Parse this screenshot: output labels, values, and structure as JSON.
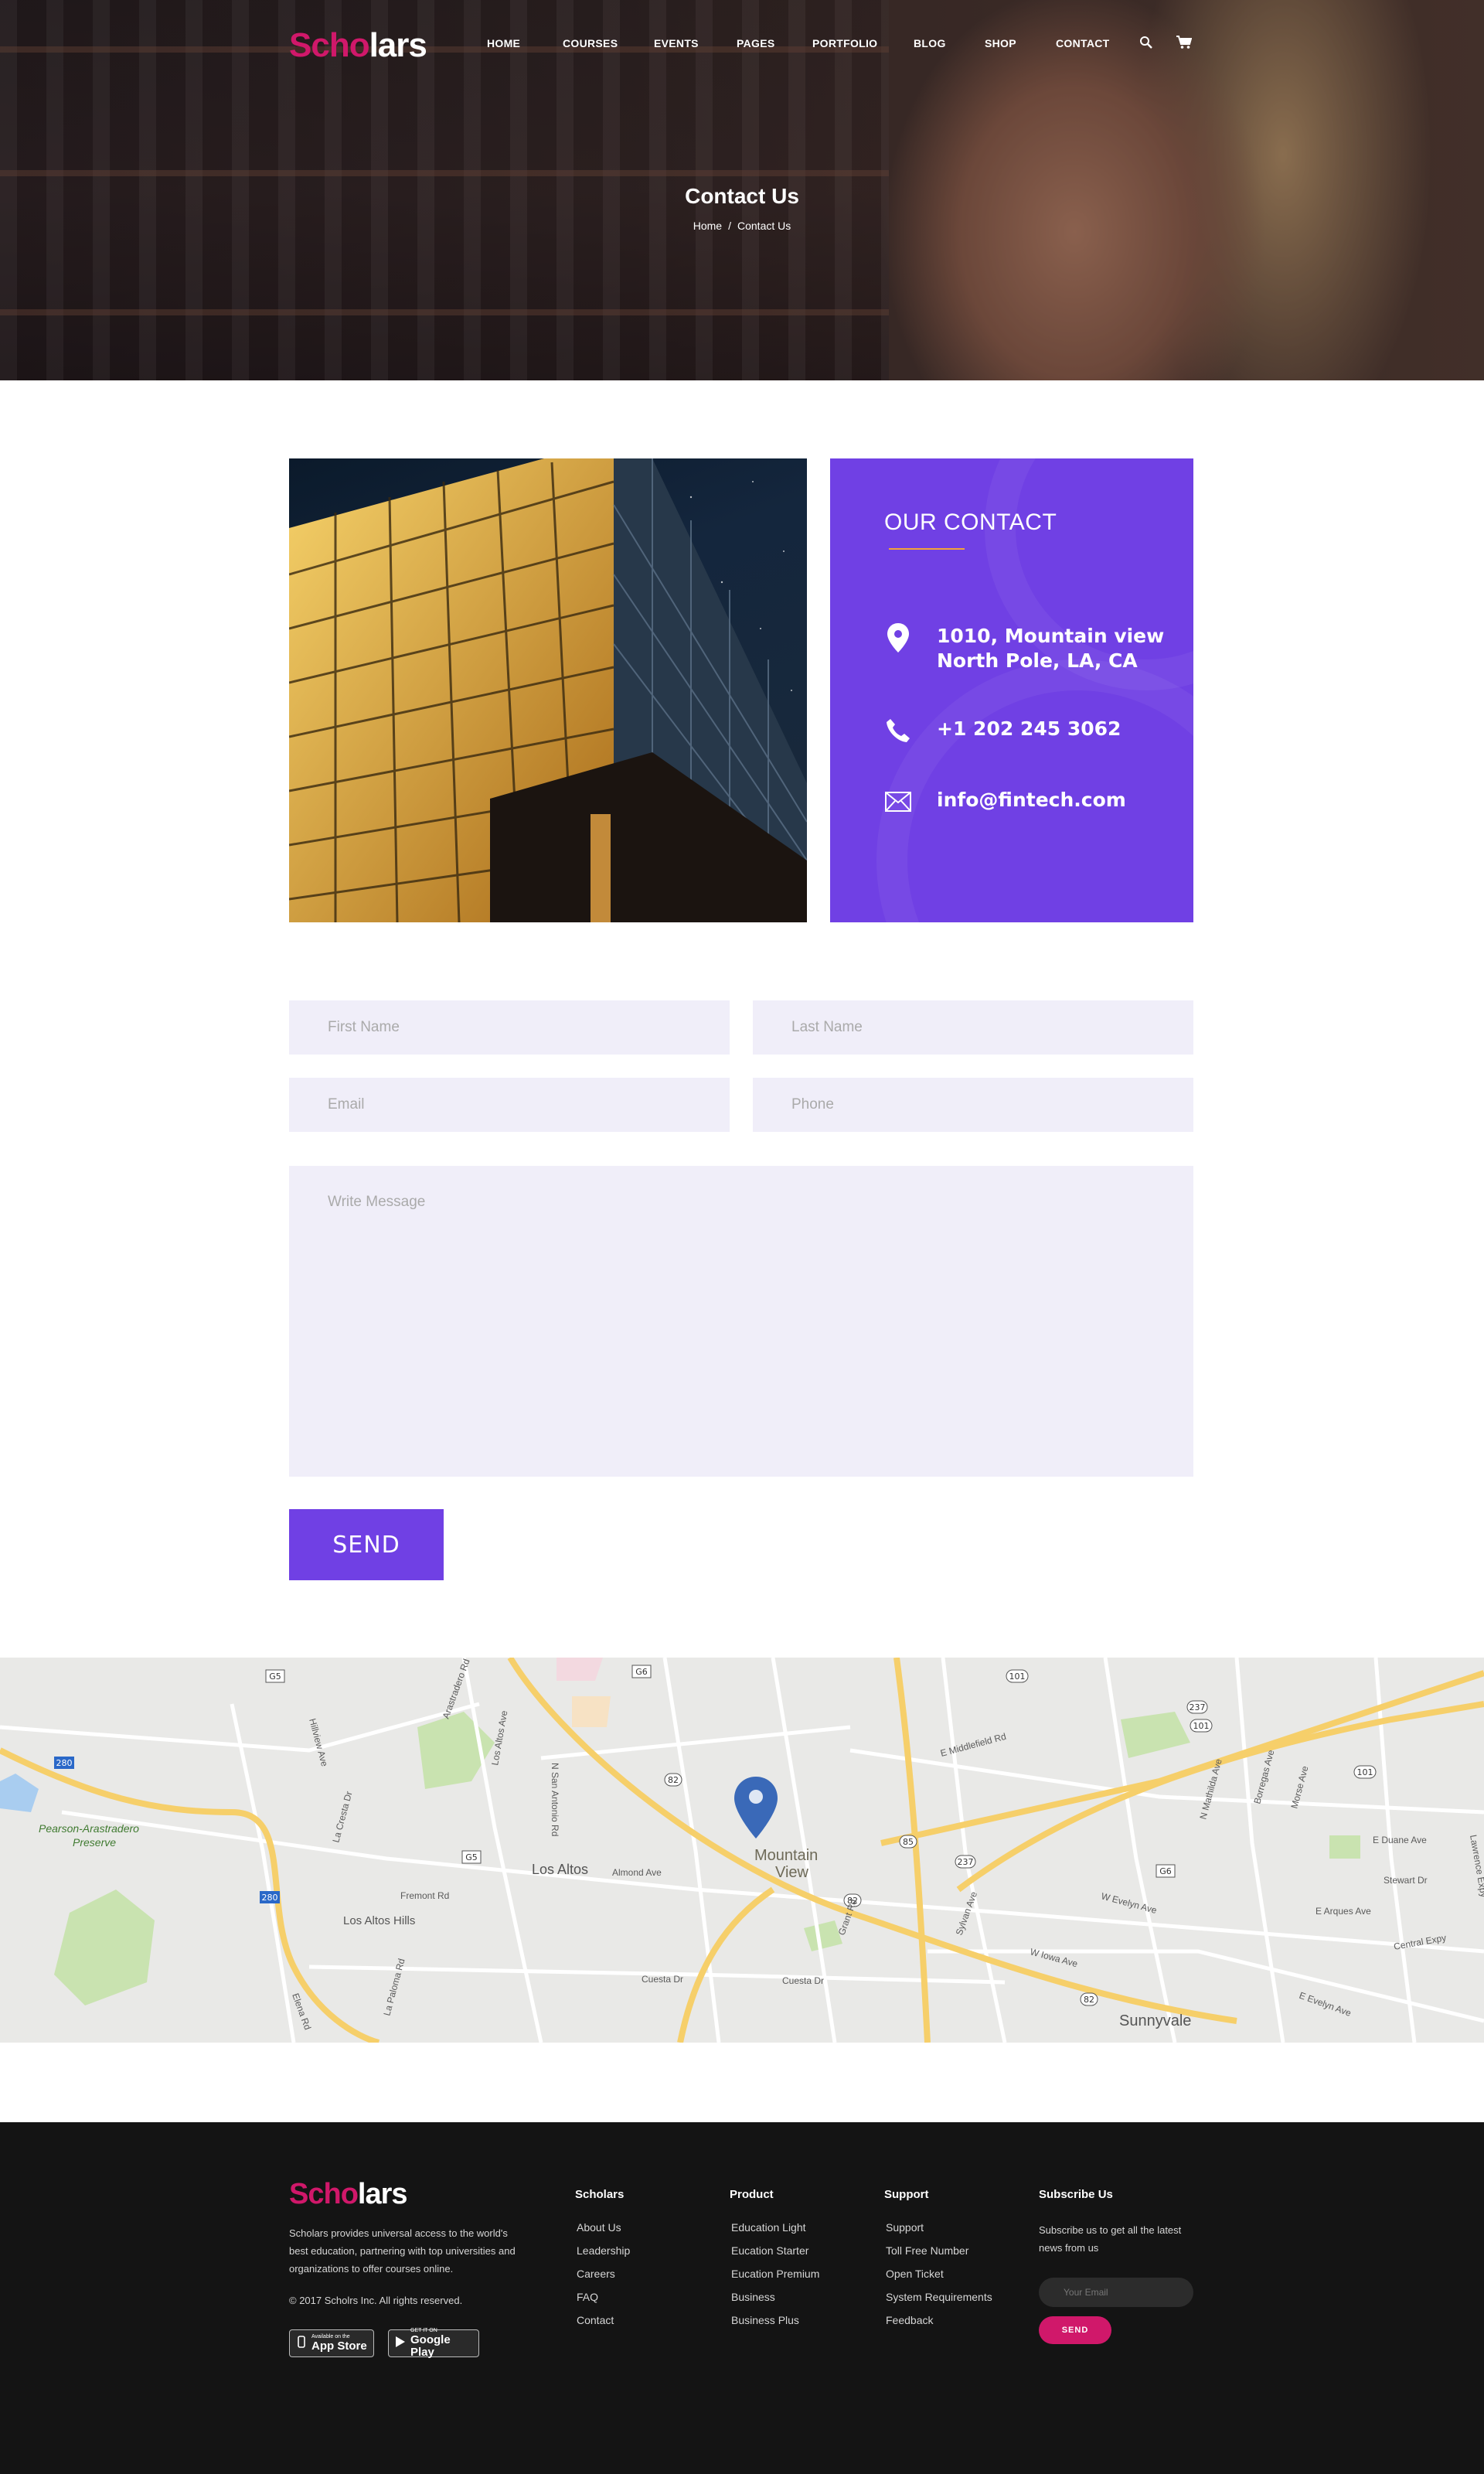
{
  "brand": {
    "logo_part1": "Scho",
    "logo_part2": "lars",
    "accent_color": "#d0186a",
    "primary_color": "#7040e4"
  },
  "nav": {
    "items": [
      {
        "label": "HOME"
      },
      {
        "label": "COURSES"
      },
      {
        "label": "EVENTS"
      },
      {
        "label": "PAGES"
      },
      {
        "label": "PORTFOLIO"
      },
      {
        "label": "BLOG"
      },
      {
        "label": "SHOP"
      },
      {
        "label": "CONTACT"
      }
    ],
    "icons": [
      "search-icon",
      "cart-icon"
    ]
  },
  "hero": {
    "title": "Contact Us",
    "breadcrumb": {
      "home": "Home",
      "separator": "/",
      "current": "Contact Us"
    }
  },
  "contact_card": {
    "title": "OUR CONTACT",
    "address_line1": "1010, Mountain view",
    "address_line2": "North Pole, LA, CA",
    "phone": "+1 202 245 3062",
    "email": "info@fintech.com",
    "icons": [
      "location-pin-icon",
      "phone-icon",
      "envelope-icon"
    ]
  },
  "form": {
    "first_name_placeholder": "First Name",
    "last_name_placeholder": "Last Name",
    "email_placeholder": "Email",
    "phone_placeholder": "Phone",
    "message_placeholder": "Write Message",
    "send_label": "SEND"
  },
  "map": {
    "labels": {
      "mountain_view_1": "Mountain",
      "mountain_view_2": "View",
      "los_altos": "Los Altos",
      "los_altos_hills": "Los Altos Hills",
      "sunnyvale": "Sunnyvale",
      "preserve_1": "Pearson-Arastradero",
      "preserve_2": "Preserve",
      "almond_ave": "Almond Ave",
      "fremont_rd": "Fremont Rd",
      "cuesta_dr_1": "Cuesta Dr",
      "cuesta_dr_2": "Cuesta Dr",
      "e_middlefield_rd": "E Middlefield Rd",
      "w_evelyn_ave": "W Evelyn Ave",
      "e_arques_ave": "E Arques Ave",
      "e_duane_ave": "E Duane Ave",
      "stewart_dr": "Stewart Dr",
      "central_expy": "Central Expy",
      "w_iowa_ave": "W Iowa Ave",
      "e_evelyn_ave": "E Evelyn Ave",
      "lawrence_expy": "Lawrence Expy",
      "grant_rd": "Grant Rd",
      "sylvan_ave": "Sylvan Ave",
      "n_san_antonio_rd": "N San Antonio Rd",
      "los_altos_ave": "Los Altos Ave",
      "hillview_ave": "Hillview Ave",
      "la_cresta_dr": "La Cresta Dr",
      "arastradero_rd": "Arastradero Rd",
      "elena_rd": "Elena Rd",
      "la_paloma_rd": "La Paloma Rd",
      "n_mathilda_ave": "N Mathilda Ave",
      "borregas_ave": "Borregas Ave",
      "moffett_ave": "Morse Ave"
    },
    "shields": [
      "280",
      "280",
      "G5",
      "G5",
      "G6",
      "G6",
      "82",
      "82",
      "82",
      "85",
      "237",
      "237",
      "101",
      "101",
      "101",
      "92"
    ]
  },
  "footer": {
    "logo_part1": "Scho",
    "logo_part2": "lars",
    "description": "Scholars provides universal access to the world's best education, partnering with top universities and organizations to offer courses online.",
    "copyright": "© 2017 Scholrs Inc. All rights reserved.",
    "app_store_small": "Available on the",
    "app_store_big": "App Store",
    "google_play_small": "GET IT ON",
    "google_play_big": "Google Play",
    "columns": [
      {
        "title": "Scholars",
        "links": [
          "About Us",
          "Leadership",
          "Careers",
          "FAQ",
          "Contact"
        ]
      },
      {
        "title": "Product",
        "links": [
          "Education Light",
          "Eucation Starter",
          "Eucation Premium",
          "Business",
          "Business Plus"
        ]
      },
      {
        "title": "Support",
        "links": [
          "Support",
          "Toll Free Number",
          "Open Ticket",
          "System Requirements",
          "Feedback"
        ]
      }
    ],
    "subscribe": {
      "title": "Subscribe Us",
      "description": "Subscribe us to get all the latest news from us",
      "email_placeholder": "Your Email",
      "send_label": "SEND"
    }
  }
}
